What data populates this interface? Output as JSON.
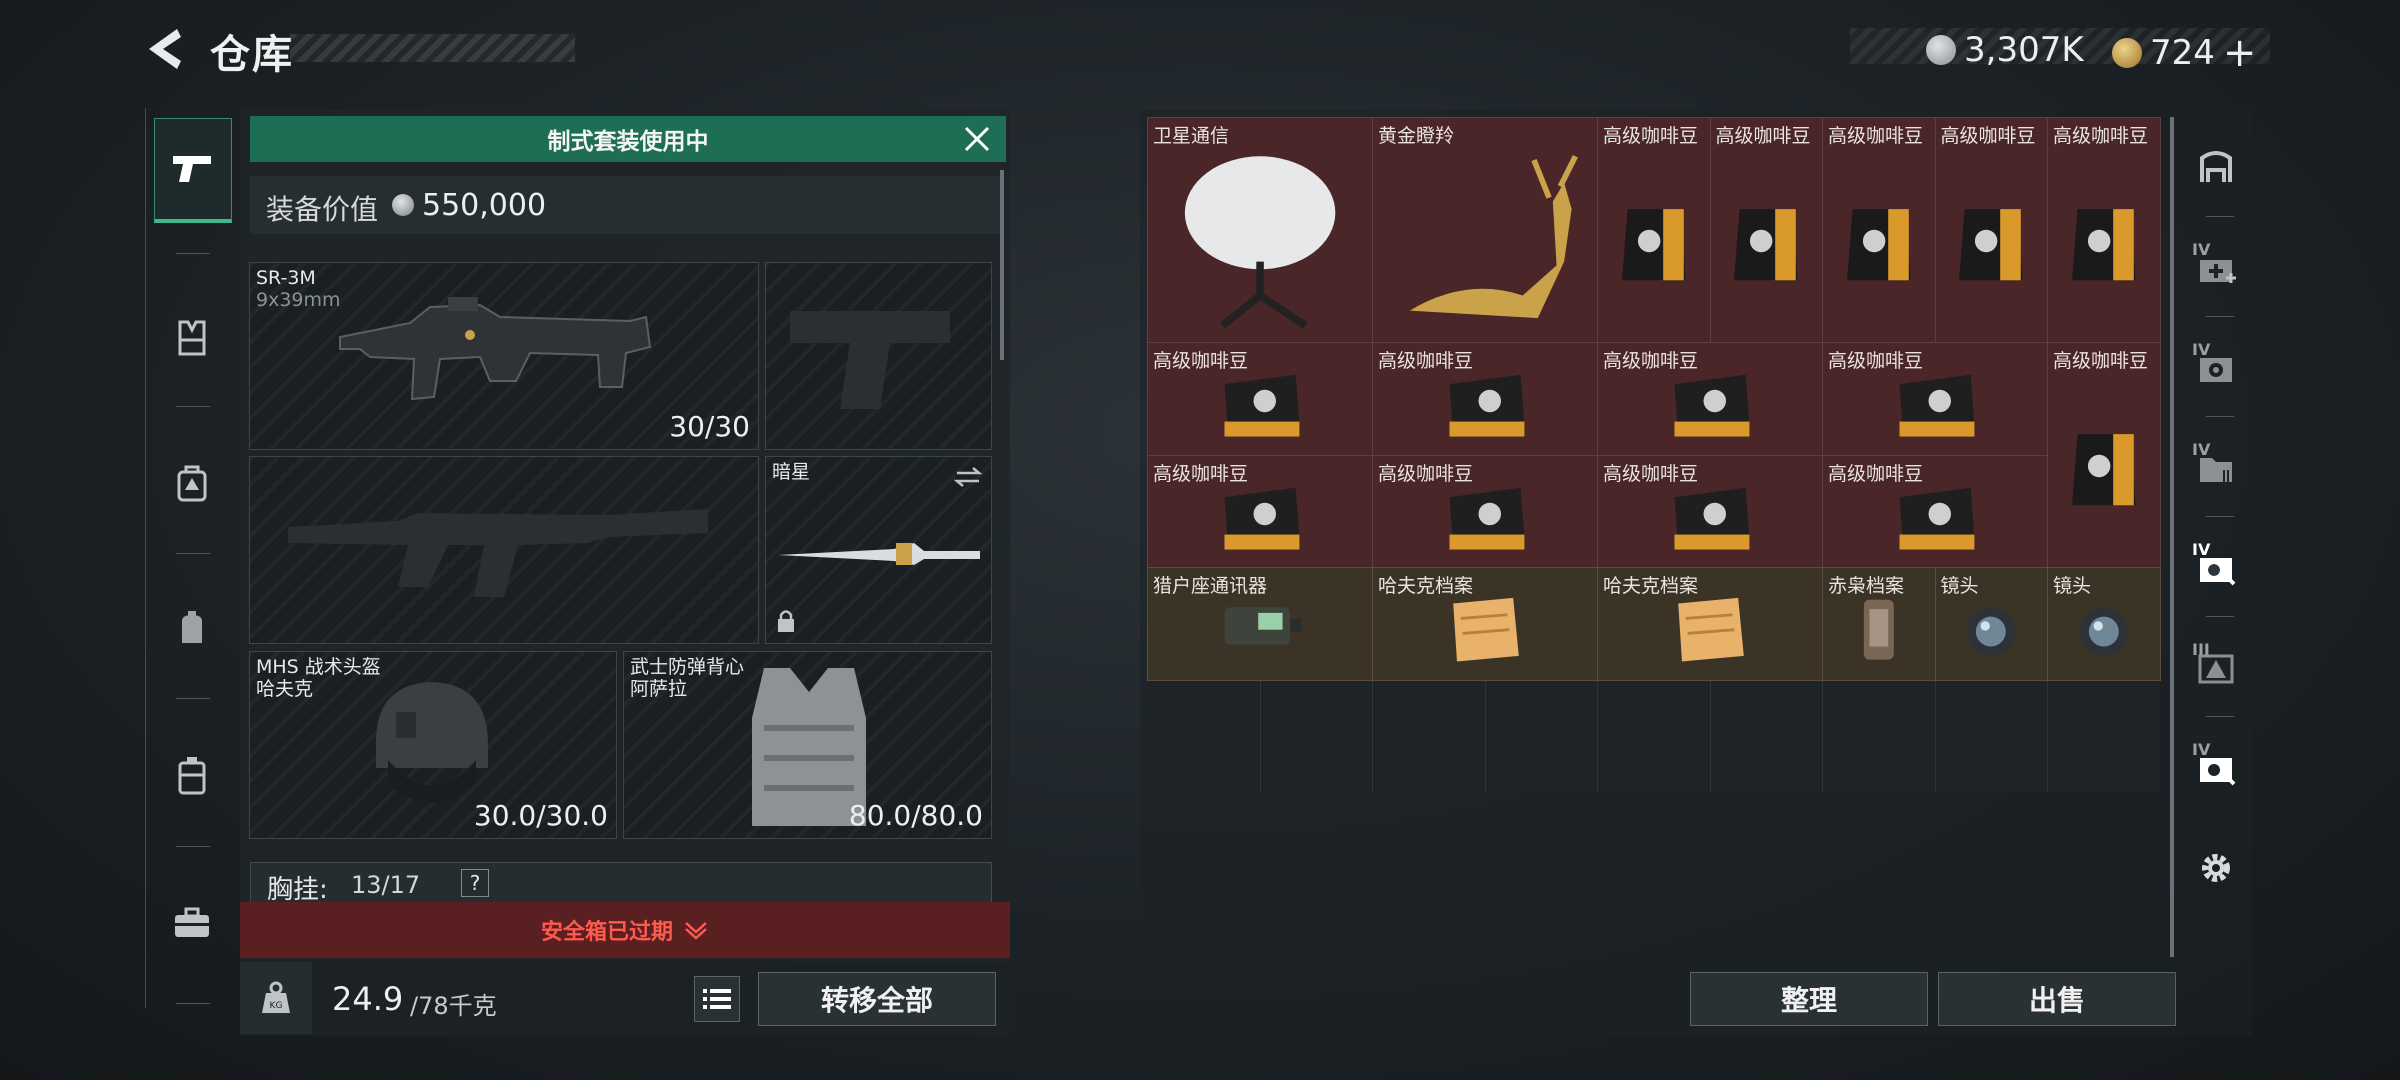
{
  "header": {
    "title": "仓库",
    "currency": [
      {
        "name": "silver-coin",
        "value": "3,307K",
        "color": "#b8bcc0"
      },
      {
        "name": "gold-triangle-coin",
        "value": "724",
        "color": "#c9a24a"
      }
    ],
    "add_symbol": "+"
  },
  "colors": {
    "accent_green": "#1e6e55",
    "warning_red": "#ff5a4e",
    "item_red_bg": "#4a2629",
    "item_brown_bg": "#3c3327"
  },
  "left_nav": {
    "items": [
      {
        "name": "weapons",
        "icon": "pistol-icon",
        "active": true
      },
      {
        "name": "helmet",
        "icon": "vest-icon"
      },
      {
        "name": "backpack",
        "icon": "backpack-icon"
      },
      {
        "name": "pouch",
        "icon": "pouch-icon"
      },
      {
        "name": "rig",
        "icon": "rig-icon"
      },
      {
        "name": "case",
        "icon": "briefcase-icon"
      }
    ]
  },
  "loadout": {
    "banner": "制式套装使用中",
    "equip_value_label": "装备价值",
    "equip_value": "550,000",
    "primary": {
      "name": "SR-3M",
      "ammo": "9x39mm",
      "count": "30/30"
    },
    "melee": {
      "name": "暗星"
    },
    "helmet": {
      "name": "MHS 战术头盔",
      "brand": "哈夫克",
      "durability": "30.0/30.0"
    },
    "armor": {
      "name": "武士防弹背心",
      "brand": "阿萨拉",
      "durability": "80.0/80.0"
    },
    "chest_rig": {
      "label": "胸挂:",
      "capacity": "13/17",
      "help": "?"
    },
    "safebox_notice": "安全箱已过期",
    "weight": "24.9",
    "weight_max": "/78千克",
    "weight_icon_label": "KG",
    "transfer_all": "转移全部"
  },
  "storage": {
    "items": [
      {
        "label": "卫星通信",
        "kind": "dish",
        "bg": "red"
      },
      {
        "label": "黄金瞪羚",
        "kind": "gazelle",
        "bg": "red"
      },
      {
        "label": "高级咖啡豆",
        "kind": "bag",
        "bg": "red"
      },
      {
        "label": "高级咖啡豆",
        "kind": "bag",
        "bg": "red"
      },
      {
        "label": "高级咖啡豆",
        "kind": "bag",
        "bg": "red"
      },
      {
        "label": "高级咖啡豆",
        "kind": "bag",
        "bg": "red"
      },
      {
        "label": "高级咖啡豆",
        "kind": "bag",
        "bg": "red"
      },
      {
        "label": "高级咖啡豆",
        "kind": "flatbag",
        "bg": "red"
      },
      {
        "label": "高级咖啡豆",
        "kind": "flatbag",
        "bg": "red"
      },
      {
        "label": "高级咖啡豆",
        "kind": "flatbag",
        "bg": "red"
      },
      {
        "label": "高级咖啡豆",
        "kind": "flatbag",
        "bg": "red"
      },
      {
        "label": "高级咖啡豆",
        "kind": "bag",
        "bg": "red"
      },
      {
        "label": "高级咖啡豆",
        "kind": "flatbag",
        "bg": "red"
      },
      {
        "label": "高级咖啡豆",
        "kind": "flatbag",
        "bg": "red"
      },
      {
        "label": "高级咖啡豆",
        "kind": "flatbag",
        "bg": "red"
      },
      {
        "label": "高级咖啡豆",
        "kind": "flatbag",
        "bg": "red"
      },
      {
        "label": "猎户座通讯器",
        "kind": "radio",
        "bg": "brown"
      },
      {
        "label": "哈夫克档案",
        "kind": "file",
        "bg": "brown"
      },
      {
        "label": "哈夫克档案",
        "kind": "file",
        "bg": "brown"
      },
      {
        "label": "赤枭档案",
        "kind": "bottle",
        "bg": "brown"
      },
      {
        "label": "镜头",
        "kind": "lens",
        "bg": "brown"
      },
      {
        "label": "镜头",
        "kind": "lens",
        "bg": "brown"
      }
    ],
    "sort_button": "整理",
    "sell_button": "出售"
  },
  "right_tabs": [
    {
      "name": "all",
      "icon": "shelf-icon",
      "tier": ""
    },
    {
      "name": "medical",
      "icon": "medkit-icon",
      "tier": "IV"
    },
    {
      "name": "storage-1",
      "icon": "gear-box-icon",
      "tier": "IV"
    },
    {
      "name": "storage-2",
      "icon": "archive-icon",
      "tier": "IV"
    },
    {
      "name": "storage-3",
      "icon": "tool-box-icon",
      "tier": "IV",
      "active": true
    },
    {
      "name": "storage-4",
      "icon": "warning-box-icon",
      "tier": "III"
    },
    {
      "name": "storage-5",
      "icon": "tool-box-icon",
      "tier": "IV"
    },
    {
      "name": "settings",
      "icon": "gear-icon",
      "tier": ""
    }
  ]
}
